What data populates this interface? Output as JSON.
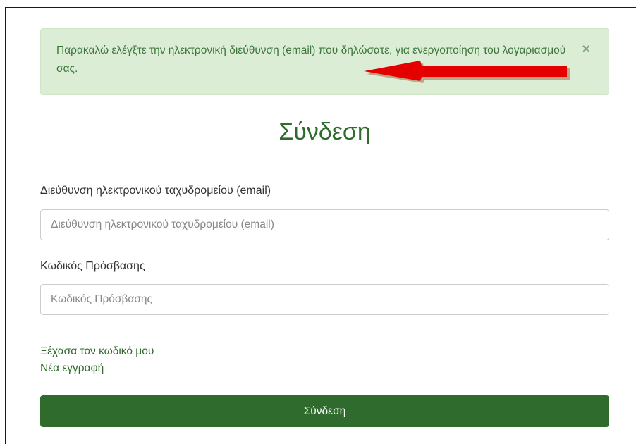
{
  "alert": {
    "message": "Παρακαλώ ελέγξτε την ηλεκτρονική διεύθυνση (email) που δηλώσατε, για ενεργοποίηση του λογαριασμού σας.",
    "close_symbol": "×",
    "background": "#dcedd5",
    "text_color": "#3c763d"
  },
  "annotation": {
    "icon": "arrow-left-icon",
    "color": "#e50000"
  },
  "login": {
    "title": "Σύνδεση",
    "email_label": "Διεύθυνση ηλεκτρονικού ταχυδρομείου (email)",
    "email_placeholder": "Διεύθυνση ηλεκτρονικού ταχυδρομείου (email)",
    "email_value": "",
    "password_label": "Κωδικός Πρόσβασης",
    "password_placeholder": "Κωδικός Πρόσβασης",
    "password_value": "",
    "forgot_link": "Ξέχασα τον κωδικό μου",
    "register_link": "Νέα εγγραφή",
    "submit_label": "Σύνδεση",
    "accent": "#2f6b2c"
  }
}
